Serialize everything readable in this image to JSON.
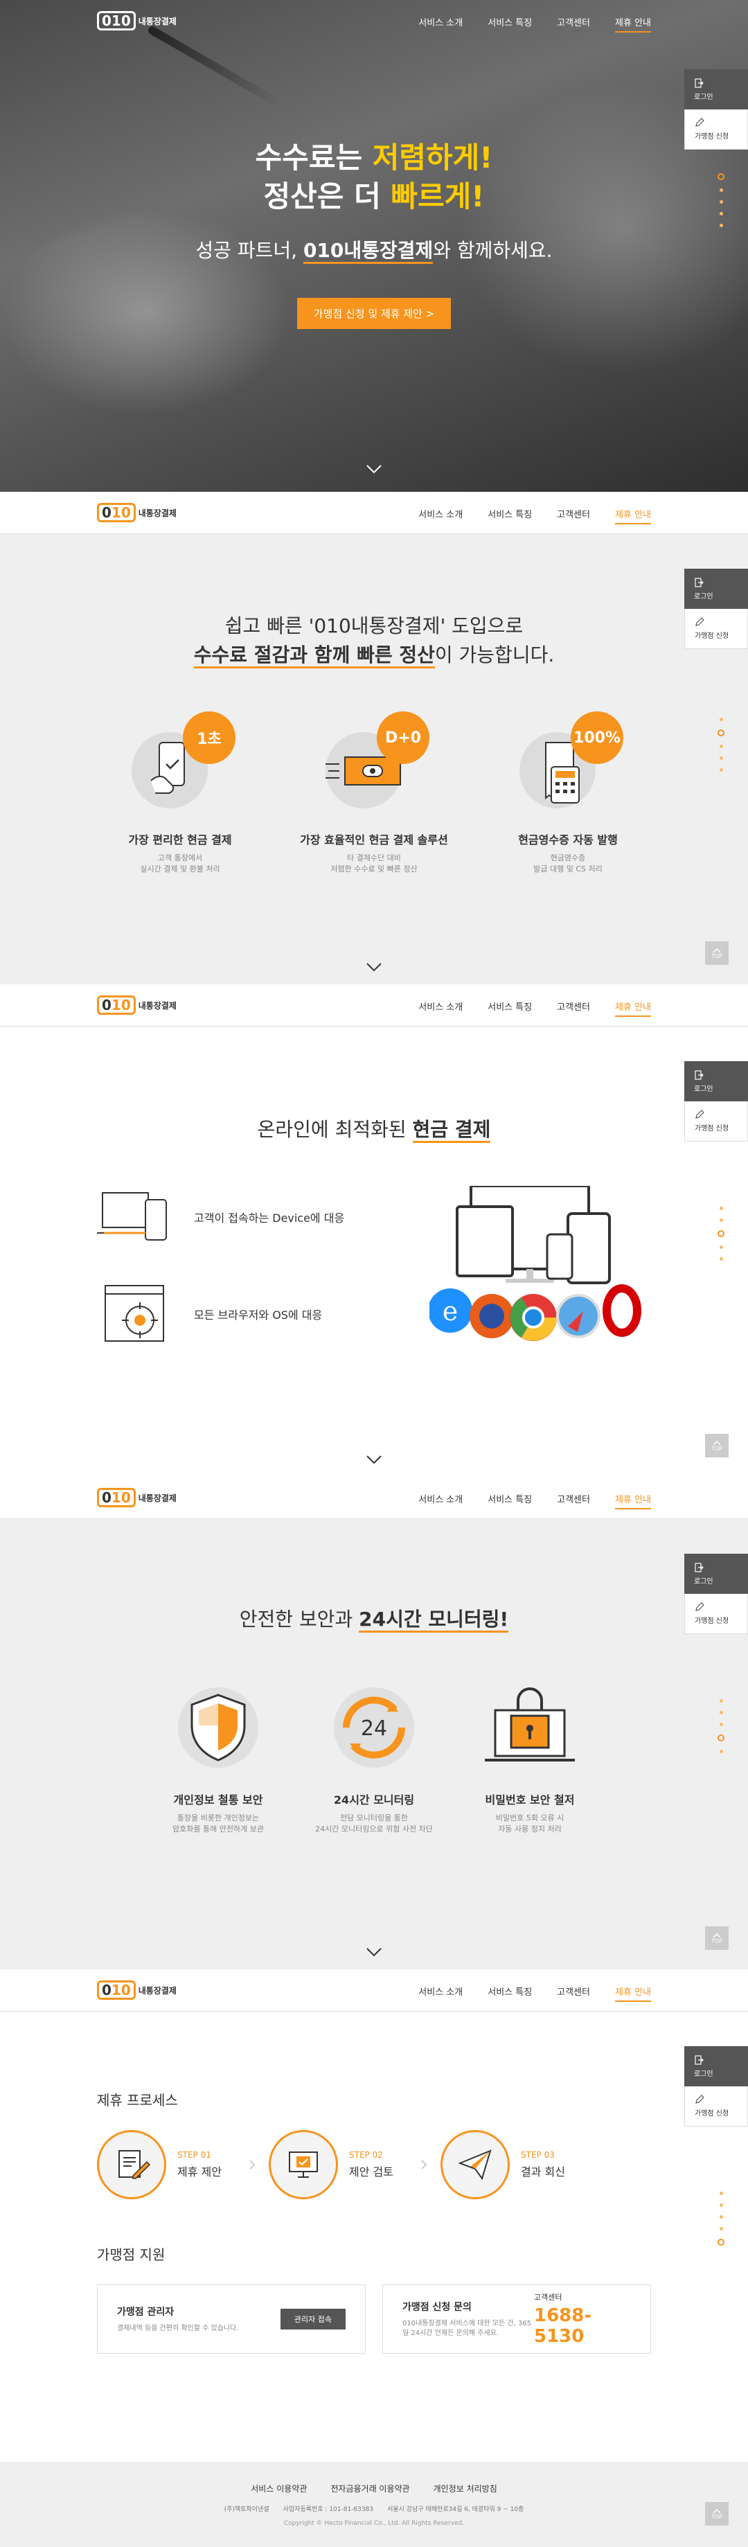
{
  "logo": {
    "mark_zero": "0",
    "mark_rest": "10",
    "text": "내통장결제"
  },
  "nav": {
    "items": [
      "서비스 소개",
      "서비스 특징",
      "고객센터",
      "제휴 안내"
    ],
    "active": "제휴 안내"
  },
  "quick": {
    "login": "로그인",
    "apply": "가맹점 신청"
  },
  "top_label": "TOP",
  "hero": {
    "line1_pre": "수수료는 ",
    "line1_hl": "저렴하게!",
    "line2_pre": "정산은 더 ",
    "line2_hl": "빠르게!",
    "sub_pre": "성공 파트너, ",
    "sub_brand": "010내통장결제",
    "sub_post": "와 함께하세요.",
    "button": "가맹점 신청 및 제휴 제안 >"
  },
  "intro": {
    "title_line1": "쉽고 빠른 '010내통장결제' 도입으로",
    "title_strong": "수수료 절감과 함께 빠른 정산",
    "title_post": "이 가능합니다.",
    "features": [
      {
        "badge": "1초",
        "title": "가장 편리한 현금 결제",
        "desc1": "고객 통장에서",
        "desc2": "실시간 결제 및 환불 처리"
      },
      {
        "badge": "D+0",
        "title": "가장 효율적인 현금 결제 솔루션",
        "desc1": "타 결제수단 대비",
        "desc2": "저렴한 수수료 및 빠른 정산"
      },
      {
        "badge": "100%",
        "title": "현금영수증 자동 발행",
        "desc1": "현금영수증",
        "desc2": "발급 대행 및 CS 처리"
      }
    ]
  },
  "online": {
    "title_pre": "온라인에 최적화된 ",
    "title_strong": "현금 결제",
    "items": [
      "고객이 접속하는 Device에 대응",
      "모든 브라우저와 OS에 대응"
    ]
  },
  "security": {
    "title_pre": "안전한 보안과 ",
    "title_strong": "24시간 모니터링!",
    "clock_num": "24",
    "features": [
      {
        "title": "개인정보 철통 보안",
        "desc1": "통장을 비롯한 개인정보는",
        "desc2": "암호화를 통해 안전하게 보관"
      },
      {
        "title": "24시간 모니터링",
        "desc1": "전담 모니터링을 통한",
        "desc2": "24시간 모니터링으로 위험 사전 차단"
      },
      {
        "title": "비밀번호 보안 철저",
        "desc1": "비밀번호 5회 오류 시",
        "desc2": "자동 사용 정지 처리"
      }
    ]
  },
  "partner": {
    "process_title": "제휴 프로세스",
    "steps": [
      {
        "no": "STEP 01",
        "name": "제휴 제안"
      },
      {
        "no": "STEP 02",
        "name": "제안 검토"
      },
      {
        "no": "STEP 03",
        "name": "결과 회신"
      }
    ],
    "support_title": "가맹점 지원",
    "admin": {
      "title": "가맹점 관리자",
      "desc": "결제내역 등을 간편히 확인할 수 있습니다.",
      "button": "관리자 접속"
    },
    "apply": {
      "title": "가맹점 신청 문의",
      "desc": "010내통장결제 서비스에 대한 모든 건, 365일 24시간 언제든 문의해 주세요.",
      "cc_label": "고객센터",
      "cc_number": "1688-5130"
    }
  },
  "footer": {
    "links": [
      "서비스 이용약관",
      "전자금융거래 이용약관",
      "개인정보 처리방침"
    ],
    "company": "(주)헥토파이낸셜",
    "biz_no": "사업자등록번호 : 101-81-63383",
    "address": "서울시 강남구 테헤란로34길 6, 태광타워 9 ~ 10층",
    "copyright": "Copyright © Hecto Financial Co., Ltd. All Rights Reserved."
  },
  "colors": {
    "accent": "#f7941d",
    "highlight": "#ffcc00",
    "dark_button": "#555555"
  }
}
